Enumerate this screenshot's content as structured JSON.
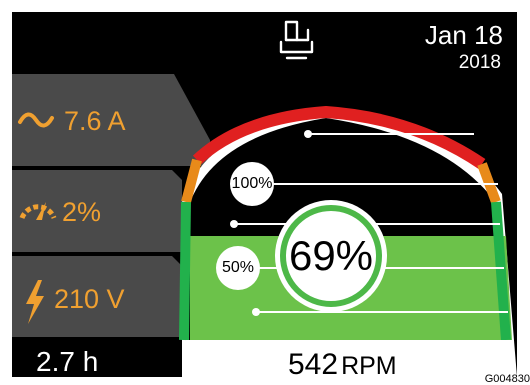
{
  "header": {
    "date_line1": "Jan 18",
    "date_line2": "2018",
    "center_icon": "operator-seat-icon"
  },
  "status": {
    "current": {
      "icon": "tilde-wave-icon",
      "value": "7.6 A"
    },
    "load": {
      "icon": "speedometer-icon",
      "value": "2%"
    },
    "voltage": {
      "icon": "lightning-bolt-icon",
      "value": "210 V"
    },
    "hours": "2.7 h"
  },
  "gauge": {
    "mark_high": "100%",
    "mark_mid": "50%",
    "center_value": "69%",
    "level_fraction": 0.69,
    "rpm_value": "542",
    "rpm_unit": "RPM",
    "zone_colors": {
      "red": "#e02020",
      "orange": "#e88a1a",
      "green": "#22b14c",
      "fill": "#6cc24a"
    }
  },
  "image_id": "G004830"
}
